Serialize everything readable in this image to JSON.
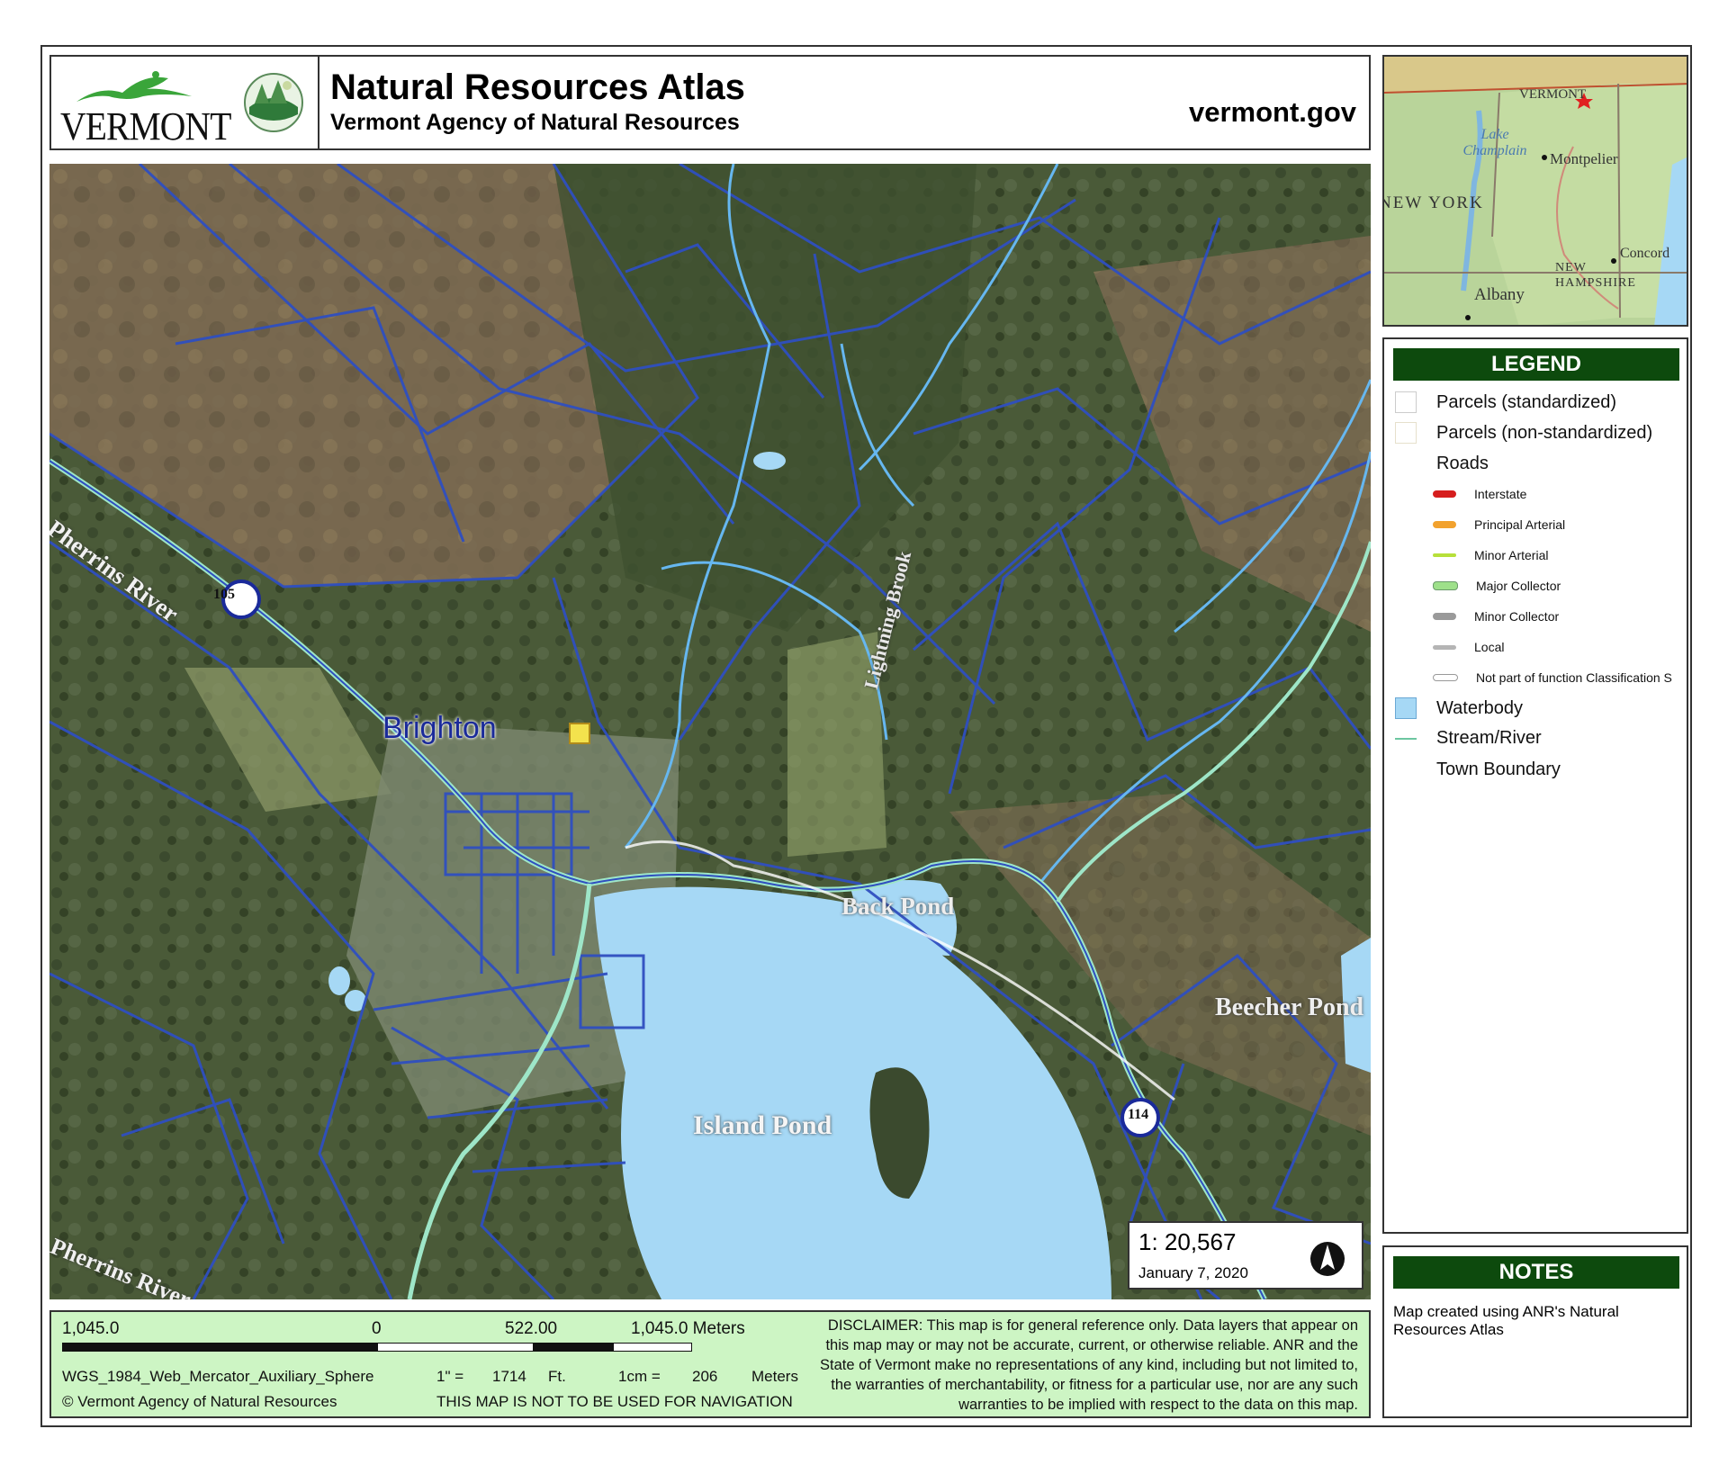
{
  "header": {
    "logo_text": "VERMONT",
    "title": "Natural Resources Atlas",
    "subtitle": "Vermont Agency of Natural Resources",
    "website": "vermont.gov"
  },
  "map": {
    "labels": {
      "river_1": "Pherrins River",
      "town": "Brighton",
      "brook": "Lightning Brook",
      "back_pond": "Back Pond",
      "beecher_pond": "Beecher Pond",
      "island_pond": "Island Pond",
      "river_2": "Pherrins River",
      "route_105": "105",
      "route_114": "114"
    },
    "scale": {
      "ratio": "1:  20,567",
      "date": "January 7, 2020"
    }
  },
  "inset": {
    "labels": {
      "vermont": "VERMONT",
      "lake": "Lake Champlain",
      "montpelier": "Montpelier",
      "new_york": "NEW YORK",
      "concord": "Concord",
      "new_hampshire": "NEW HAMPSHIRE",
      "albany": "Albany"
    }
  },
  "legend": {
    "title": "LEGEND",
    "items": [
      {
        "label": "Parcels (standardized)"
      },
      {
        "label": "Parcels (non-standardized)"
      },
      {
        "label": "Roads"
      }
    ],
    "roads": [
      {
        "label": "Interstate",
        "color": "#d61e1e"
      },
      {
        "label": "Principal Arterial",
        "color": "#f2a22e"
      },
      {
        "label": "Minor Arterial",
        "color": "#b7e03a"
      },
      {
        "label": "Major Collector",
        "color": "#9ee08a"
      },
      {
        "label": "Minor Collector",
        "color": "#9a9a9a"
      },
      {
        "label": "Local",
        "color": "#b5b5b5"
      },
      {
        "label": "Not part of function Classification S",
        "color": "#d9d9d9"
      }
    ],
    "others": [
      {
        "label": "Waterbody",
        "color": "#a6d8f5"
      },
      {
        "label": "Stream/River",
        "color": "#6cc6a0"
      },
      {
        "label": "Town Boundary",
        "color": "#ffffff"
      }
    ]
  },
  "notes": {
    "title": "NOTES",
    "text": "Map created using ANR's Natural Resources Atlas"
  },
  "footer": {
    "scale_left": "1,045.0",
    "scale_zero": "0",
    "scale_mid": "522.00",
    "scale_right": "1,045.0 Meters",
    "projection": "WGS_1984_Web_Mercator_Auxiliary_Sphere",
    "copyright": "© Vermont Agency of Natural Resources",
    "inch_label": "1\" =",
    "inch_value": "1714",
    "inch_unit": "Ft.",
    "cm_label": "1cm =",
    "cm_value": "206",
    "cm_unit": "Meters",
    "navigation": "THIS MAP IS NOT TO BE USED FOR NAVIGATION",
    "disclaimer": "DISCLAIMER: This map is for general reference only. Data layers that appear on this map may or may not be accurate, current, or otherwise reliable. ANR and the State of Vermont make no representations of any kind, including but not limited to, the warranties of merchantability, or fitness for a particular use, nor are any such warranties to be implied with respect to the data on this map."
  }
}
